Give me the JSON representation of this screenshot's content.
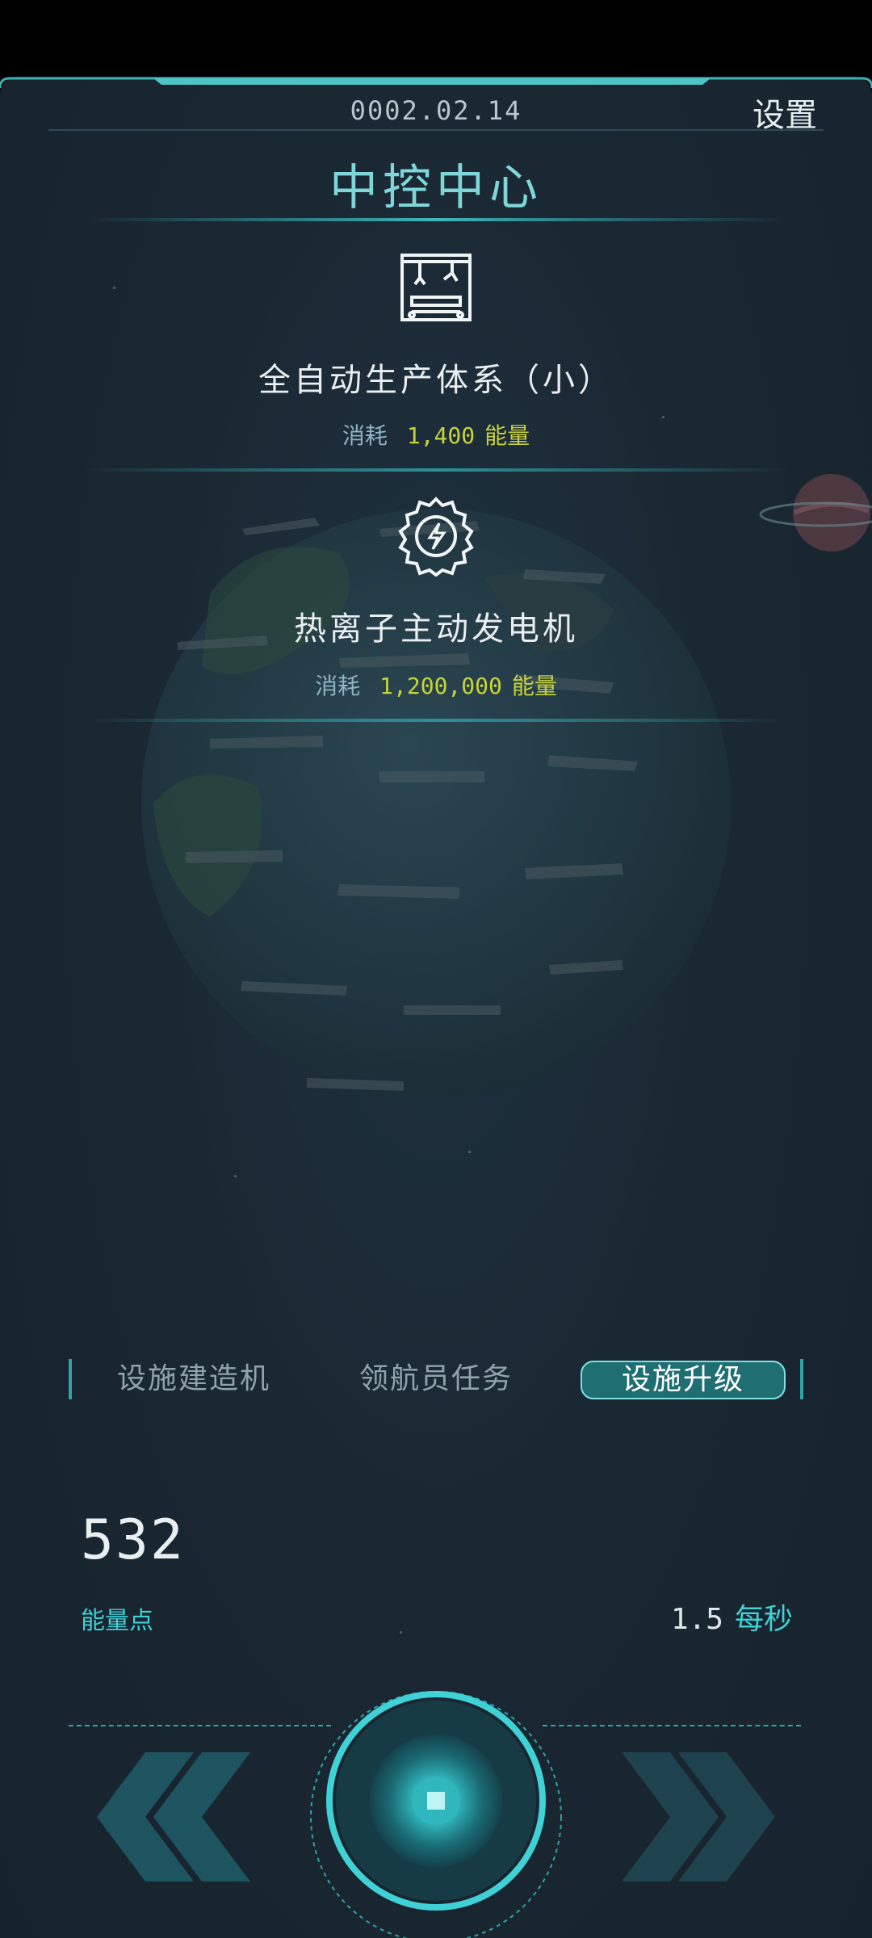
{
  "header": {
    "date": "0002.02.14",
    "settings_label": "设置",
    "title": "中控中心"
  },
  "items": [
    {
      "name": "全自动生产体系（小）",
      "cost_label": "消耗",
      "cost_value": "1,400",
      "cost_unit": "能量",
      "icon": "factory-assembly-line-icon"
    },
    {
      "name": "热离子主动发电机",
      "cost_label": "消耗",
      "cost_value": "1,200,000",
      "cost_unit": "能量",
      "icon": "lightning-gear-icon"
    }
  ],
  "tabs": [
    {
      "label": "设施建造机",
      "active": false
    },
    {
      "label": "领航员任务",
      "active": false
    },
    {
      "label": "设施升级",
      "active": true
    }
  ],
  "energy": {
    "value": "532",
    "label": "能量点",
    "rate_value": "1.5",
    "rate_unit": "每秒"
  },
  "controls": {
    "prev_icon": "double-chevron-left-icon",
    "next_icon": "double-chevron-right-icon",
    "center_icon": "stop-core-button-icon"
  },
  "colors": {
    "background": "#1a2833",
    "accent_cyan": "#3fd1d6",
    "title_teal": "#7fd6d8",
    "cost_yellow": "#c8d33b",
    "text_light": "#e9eef0"
  }
}
